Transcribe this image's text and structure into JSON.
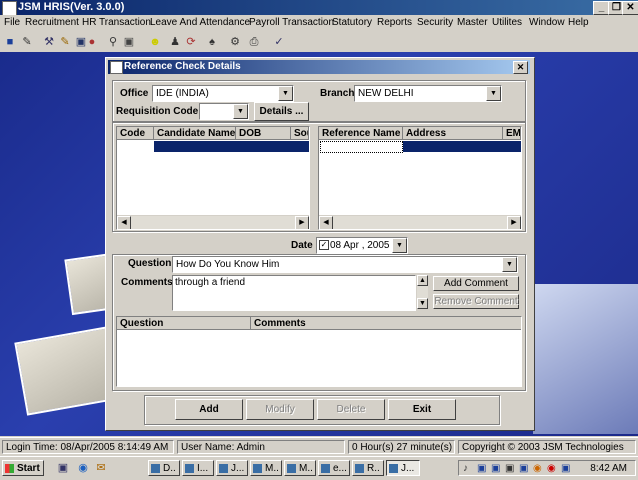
{
  "app": {
    "title": "JSM HRIS(Ver. 3.0.0)"
  },
  "window_controls": {
    "minimize": "_",
    "restore": "❐",
    "close": "✕"
  },
  "menu": [
    "File",
    "Recruitment",
    "HR Transaction",
    "Leave And Attendance",
    "Payroll Transaction",
    "Statutory",
    "Reports",
    "Security",
    "Master",
    "Utilites",
    "Window",
    "Help"
  ],
  "toolbar_icons": [
    "users-icon",
    "edit-icon",
    "tools-icon",
    "pencil-icon",
    "book-icon",
    "search-icon",
    "key-icon",
    "smiley-icon",
    "person-icon",
    "refresh-icon",
    "handshake-icon",
    "settings-icon",
    "print-icon",
    "check-icon"
  ],
  "dialog": {
    "title": "Reference Check Details",
    "office_label": "Office",
    "office_value": "IDE (INDIA)",
    "branch_label": "Branch",
    "branch_value": "NEW DELHI",
    "requisition_label": "Requisition Code",
    "requisition_value": "",
    "details_button": "Details ...",
    "candidate_grid": {
      "columns": [
        "Code",
        "Candidate Name",
        "DOB",
        "Sou"
      ]
    },
    "reference_grid": {
      "columns": [
        "Reference Name",
        "Address",
        "EM"
      ]
    },
    "date_label": "Date",
    "date_value": "08 Apr , 2005",
    "question_label": "Question",
    "question_value": "How Do You Know Him",
    "comments_label": "Comments",
    "comments_value": "through a friend",
    "add_comment_button": "Add Comment",
    "remove_comment_button": "Remove Comment",
    "qa_grid": {
      "columns": [
        "Question",
        "Comments"
      ]
    },
    "buttons": {
      "add": "Add",
      "modify": "Modify",
      "delete": "Delete",
      "exit": "Exit"
    }
  },
  "status": {
    "login": "Login Time: 08/Apr/2005 8:14:49 AM",
    "user": "User Name: Admin",
    "elapsed": "0 Hour(s) 27 minute(s)",
    "copyright": "Copyright  © 2003  JSM Technologies"
  },
  "taskbar": {
    "start": "Start",
    "items": [
      "D..",
      "I...",
      "J...",
      "M..",
      "M..",
      "e...",
      "R..",
      "J..."
    ],
    "clock": "8:42 AM"
  }
}
